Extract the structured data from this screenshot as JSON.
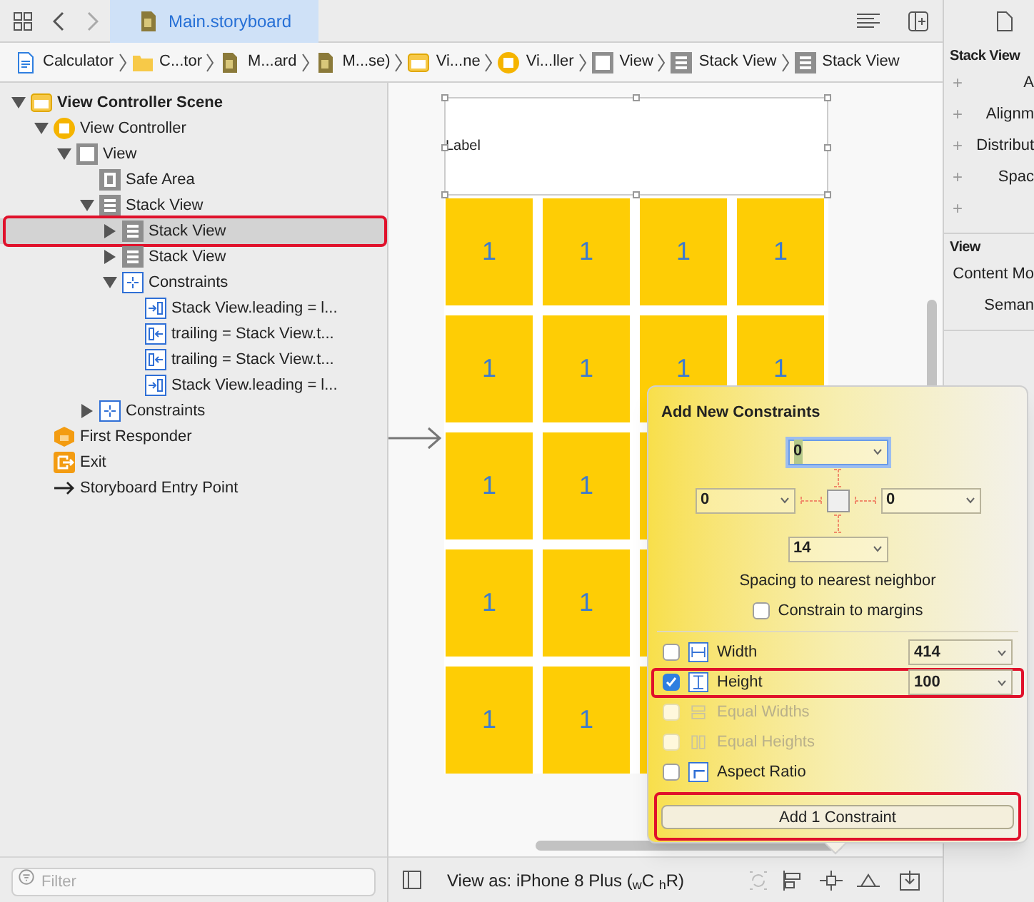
{
  "toolbar": {
    "tab": {
      "label": "Main.storyboard",
      "selected": true
    }
  },
  "breadcrumb": [
    {
      "label": "Calculator",
      "kind": "project"
    },
    {
      "label": "C...tor",
      "kind": "folder"
    },
    {
      "label": "M...ard",
      "kind": "storyboard"
    },
    {
      "label": "M...se)",
      "kind": "storyboard"
    },
    {
      "label": "Vi...ne",
      "kind": "scene"
    },
    {
      "label": "Vi...ller",
      "kind": "controller"
    },
    {
      "label": "View",
      "kind": "view"
    },
    {
      "label": "Stack View",
      "kind": "stack"
    },
    {
      "label": "Stack View",
      "kind": "stack"
    }
  ],
  "outline": [
    {
      "label": "View Controller Scene",
      "kind": "scene",
      "expanded": true,
      "selected": false,
      "highlighted": false,
      "children": [
        {
          "label": "View Controller",
          "kind": "controller",
          "expanded": true,
          "selected": false,
          "highlighted": false,
          "children": [
            {
              "label": "View",
              "kind": "view",
              "expanded": true,
              "selected": false,
              "highlighted": false,
              "children": [
                {
                  "label": "Safe Area",
                  "kind": "safe_area",
                  "selected": false,
                  "highlighted": false
                },
                {
                  "label": "Stack View",
                  "kind": "stack",
                  "expanded": true,
                  "selected": false,
                  "highlighted": false,
                  "children": [
                    {
                      "label": "Stack View",
                      "kind": "stack",
                      "expanded": false,
                      "selected": true,
                      "highlighted": true
                    },
                    {
                      "label": "Stack View",
                      "kind": "stack",
                      "expanded": false,
                      "selected": false,
                      "highlighted": false
                    },
                    {
                      "label": "Constraints",
                      "kind": "constraints",
                      "expanded": true,
                      "selected": false,
                      "highlighted": false,
                      "children": [
                        {
                          "label": "Stack View.leading = l...",
                          "kind": "leading",
                          "selected": false,
                          "highlighted": false
                        },
                        {
                          "label": "trailing = Stack View.t...",
                          "kind": "trailing",
                          "selected": false,
                          "highlighted": false
                        },
                        {
                          "label": "trailing = Stack View.t...",
                          "kind": "trailing",
                          "selected": false,
                          "highlighted": false
                        },
                        {
                          "label": "Stack View.leading = l...",
                          "kind": "leading",
                          "selected": false,
                          "highlighted": false
                        }
                      ]
                    }
                  ]
                },
                {
                  "label": "Constraints",
                  "kind": "constraints",
                  "expanded": false,
                  "selected": false,
                  "highlighted": false
                }
              ]
            }
          ]
        },
        {
          "label": "First Responder",
          "kind": "responder",
          "selected": false,
          "highlighted": false
        },
        {
          "label": "Exit",
          "kind": "exit",
          "selected": false,
          "highlighted": false
        },
        {
          "label": "Storyboard Entry Point",
          "kind": "entry",
          "selected": false,
          "highlighted": false
        }
      ]
    }
  ],
  "filter": {
    "placeholder": "Filter"
  },
  "canvas": {
    "label": "Label",
    "rows": [
      {
        "cells": [
          "1",
          "1",
          "1",
          "1"
        ]
      },
      {
        "cells": [
          "1",
          "1",
          "1",
          "1"
        ]
      },
      {
        "cells": [
          "1",
          "1"
        ]
      },
      {
        "cells": [
          "1",
          "1"
        ]
      },
      {
        "cells": [
          "1",
          "1"
        ]
      }
    ],
    "view_as": "View as: iPhone 8 Plus ($_{w}$C $_{h}$R)"
  },
  "inspector": {
    "sections": [
      {
        "title": "Stack View",
        "rows": [
          {
            "label": "A",
            "plus": "+"
          },
          {
            "label": "Alignm",
            "plus": "+"
          },
          {
            "label": "Distribut",
            "plus": "+"
          },
          {
            "label": "Spac",
            "plus": "+"
          },
          {
            "plus": "+"
          }
        ]
      },
      {
        "title": "View",
        "rows": [
          {
            "label": "Content Mo"
          },
          {
            "label": "Seman"
          }
        ]
      }
    ]
  },
  "popover": {
    "title": "Add New Constraints",
    "spacing": {
      "top": {
        "value": "0",
        "focused": true
      },
      "left": {
        "value": "0",
        "focused": false
      },
      "right": {
        "value": "0",
        "focused": false
      },
      "bottom": {
        "value": "14",
        "focused": false
      }
    },
    "spacing_caption": "Spacing to nearest neighbor",
    "margins": {
      "label": "Constrain to margins",
      "checked": false
    },
    "constraints": [
      {
        "kind": "width",
        "label": "Width",
        "checked": false,
        "disabled": false,
        "highlighted": false,
        "value": "414"
      },
      {
        "kind": "height",
        "label": "Height",
        "checked": true,
        "disabled": false,
        "highlighted": true,
        "value": "100"
      },
      {
        "kind": "equal_widths",
        "label": "Equal Widths",
        "checked": false,
        "disabled": true,
        "highlighted": false
      },
      {
        "kind": "equal_heights",
        "label": "Equal Heights",
        "checked": false,
        "disabled": true,
        "highlighted": false
      },
      {
        "kind": "aspect_ratio",
        "label": "Aspect Ratio",
        "checked": false,
        "disabled": false,
        "highlighted": false
      }
    ],
    "button": {
      "label": "Add 1 Constraint",
      "highlighted": true
    }
  }
}
